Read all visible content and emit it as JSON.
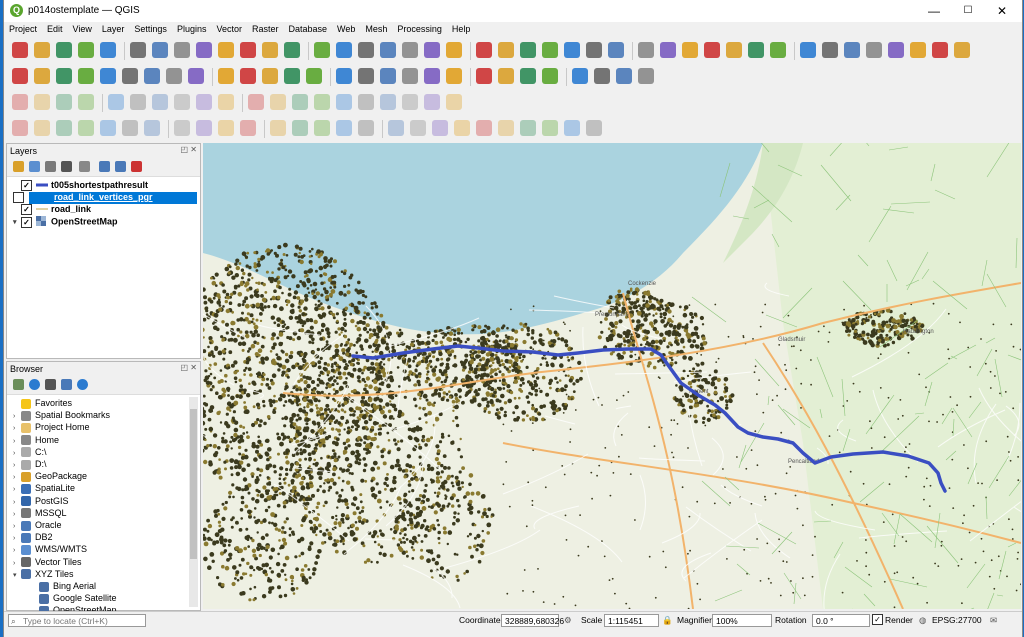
{
  "window": {
    "title": "p014ostemplate — QGIS",
    "min": "—",
    "max": "☐",
    "close": "✕"
  },
  "menu": [
    "Project",
    "Edit",
    "View",
    "Layer",
    "Settings",
    "Plugins",
    "Vector",
    "Raster",
    "Database",
    "Web",
    "Mesh",
    "Processing",
    "Help"
  ],
  "layers_panel": {
    "title": "Layers",
    "layers": [
      {
        "name": "t005shortestpathresult",
        "checked": true,
        "selected": false
      },
      {
        "name": "road_link_vertices_pgr",
        "checked": true,
        "selected": true
      },
      {
        "name": "road_link",
        "checked": true,
        "selected": false
      },
      {
        "name": "OpenStreetMap",
        "checked": true,
        "selected": false
      }
    ]
  },
  "browser_panel": {
    "title": "Browser",
    "items": [
      {
        "label": "Favorites",
        "icon": "star-icon"
      },
      {
        "label": "Spatial Bookmarks",
        "icon": "bookmark-icon"
      },
      {
        "label": "Project Home",
        "icon": "folder-icon"
      },
      {
        "label": "Home",
        "icon": "home-icon"
      },
      {
        "label": "C:\\",
        "icon": "drive-icon"
      },
      {
        "label": "D:\\",
        "icon": "drive-icon"
      },
      {
        "label": "GeoPackage",
        "icon": "geopackage-icon"
      },
      {
        "label": "SpatiaLite",
        "icon": "spatialite-icon"
      },
      {
        "label": "PostGIS",
        "icon": "postgis-icon"
      },
      {
        "label": "MSSQL",
        "icon": "mssql-icon"
      },
      {
        "label": "Oracle",
        "icon": "oracle-icon"
      },
      {
        "label": "DB2",
        "icon": "db2-icon"
      },
      {
        "label": "WMS/WMTS",
        "icon": "globe-icon"
      },
      {
        "label": "Vector Tiles",
        "icon": "vector-tiles-icon"
      },
      {
        "label": "XYZ Tiles",
        "icon": "xyz-tiles-icon"
      },
      {
        "label": "Bing Aerial",
        "icon": "grid-icon"
      },
      {
        "label": "Google Satellite",
        "icon": "grid-icon"
      },
      {
        "label": "OpenStreetMap",
        "icon": "grid-icon"
      }
    ]
  },
  "statusbar": {
    "locate_placeholder": "Type to locate (Ctrl+K)",
    "coordinate_label": "Coordinate",
    "coordinate_value": "328889,680326",
    "scale_label": "Scale",
    "scale_value": "1:115451",
    "magnifier_label": "Magnifier",
    "magnifier_value": "100%",
    "rotation_label": "Rotation",
    "rotation_value": "0.0 °",
    "render_label": "Render",
    "crs": "EPSG:27700"
  },
  "map": {
    "place_labels": [
      "Cockenzie",
      "Prestonpans",
      "Gladsmuir",
      "Tranent",
      "Haddington",
      "Pencaitland"
    ],
    "colors": {
      "sea": "#aad3df",
      "land": "#f2efe9",
      "route": "#3a4ec2",
      "vertices": "#3b3a1e",
      "fields": "#cfe8c0"
    }
  }
}
